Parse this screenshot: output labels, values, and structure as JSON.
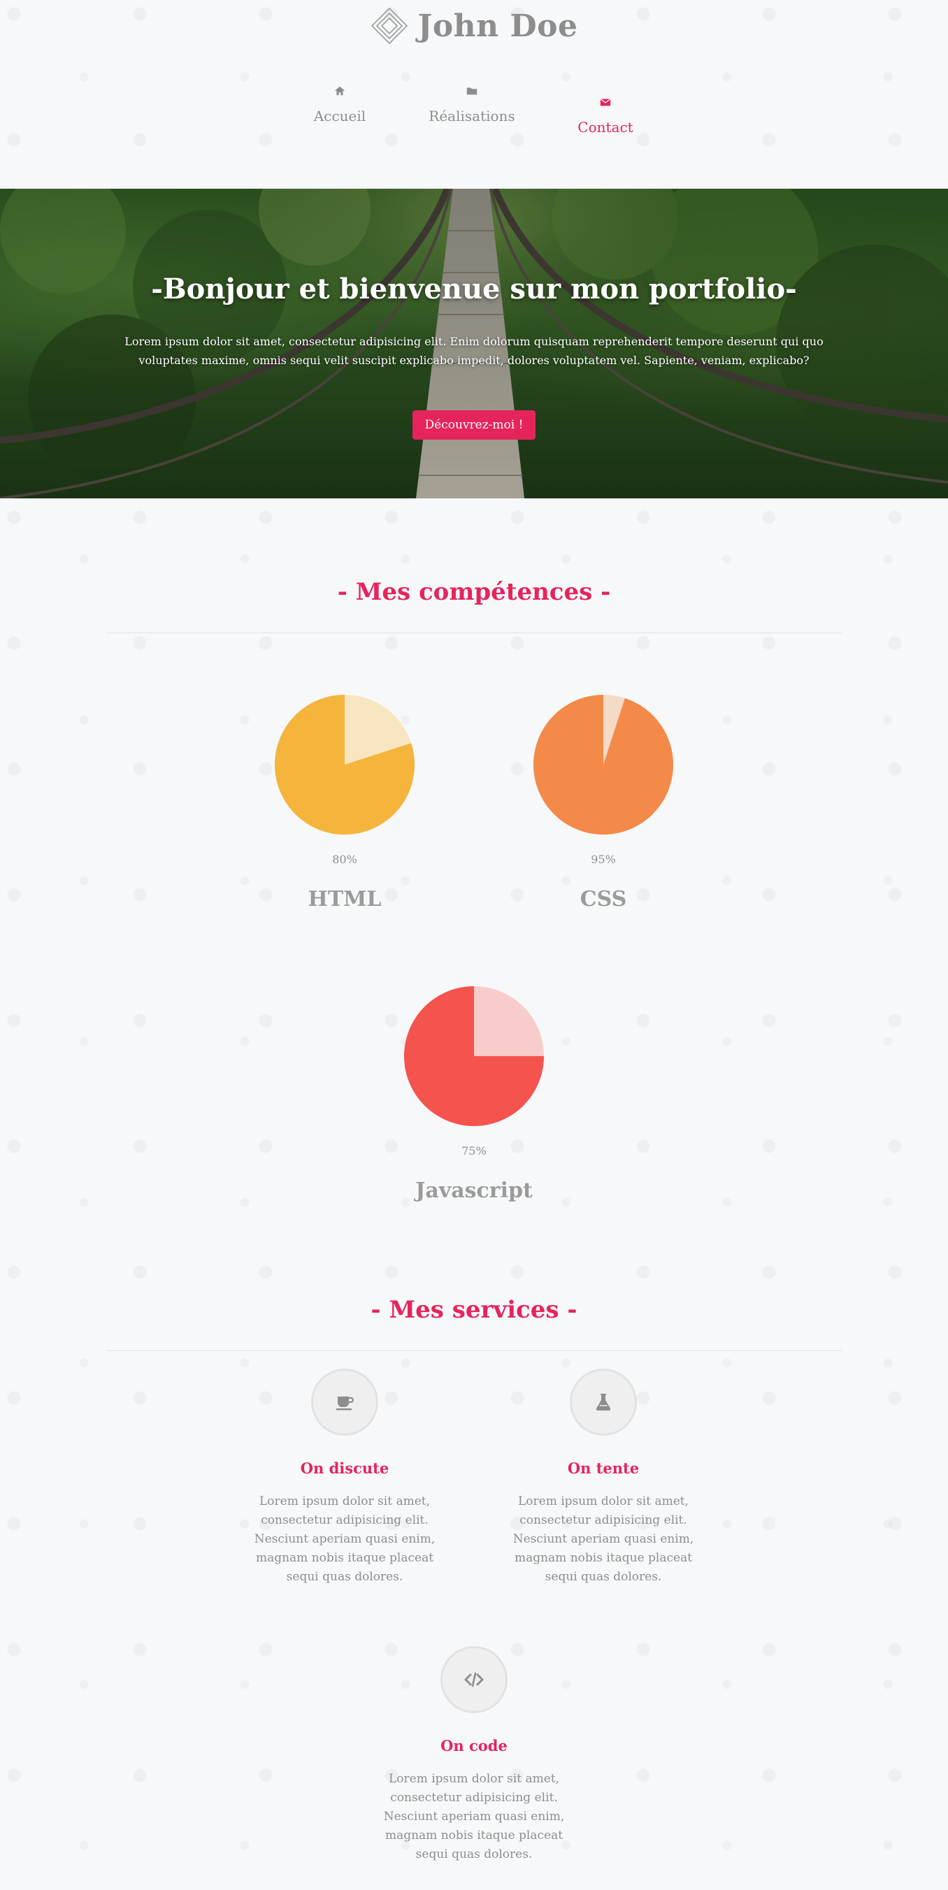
{
  "brand": {
    "name": "John Doe"
  },
  "nav": {
    "items": [
      {
        "label": "Accueil",
        "icon": "home-icon"
      },
      {
        "label": "Réalisations",
        "icon": "folder-icon"
      },
      {
        "label": "Contact",
        "icon": "envelope-icon",
        "active": true
      }
    ]
  },
  "hero": {
    "title": "-Bonjour et bienvenue sur mon portfolio-",
    "text": "Lorem ipsum dolor sit amet, consectetur adipisicing elit. Enim dolorum quisquam reprehenderit tempore deserunt qui quo voluptates maxime, omnis sequi velit suscipit explicabo impedit, dolores voluptatem vel. Sapiente, veniam, explicabo?",
    "button": "Découvrez-moi !"
  },
  "skills": {
    "title": "- Mes compétences -",
    "items": [
      {
        "name": "HTML",
        "percent_label": "80%",
        "value": 80,
        "color": "#f5b43b",
        "track": "#f8e6c2"
      },
      {
        "name": "CSS",
        "percent_label": "95%",
        "value": 95,
        "color": "#f48a4a",
        "track": "#f5dac8"
      },
      {
        "name": "Javascript",
        "percent_label": "75%",
        "value": 75,
        "color": "#f5534d",
        "track": "#f8cccb"
      }
    ]
  },
  "services": {
    "title": "- Mes services -",
    "items": [
      {
        "title": "On discute",
        "icon": "coffee-icon",
        "text": "Lorem ipsum dolor sit amet, consectetur adipisicing elit. Nesciunt aperiam quasi enim, magnam nobis itaque placeat sequi quas dolores."
      },
      {
        "title": "On tente",
        "icon": "flask-icon",
        "text": "Lorem ipsum dolor sit amet, consectetur adipisicing elit. Nesciunt aperiam quasi enim, magnam nobis itaque placeat sequi quas dolores."
      },
      {
        "title": "On code",
        "icon": "code-icon",
        "text": "Lorem ipsum dolor sit amet, consectetur adipisicing elit. Nesciunt aperiam quasi enim, magnam nobis itaque placeat sequi quas dolores."
      }
    ]
  },
  "colors": {
    "accent": "#e6245c",
    "text": "#8d8d8d",
    "background": "#f7f8fa"
  }
}
